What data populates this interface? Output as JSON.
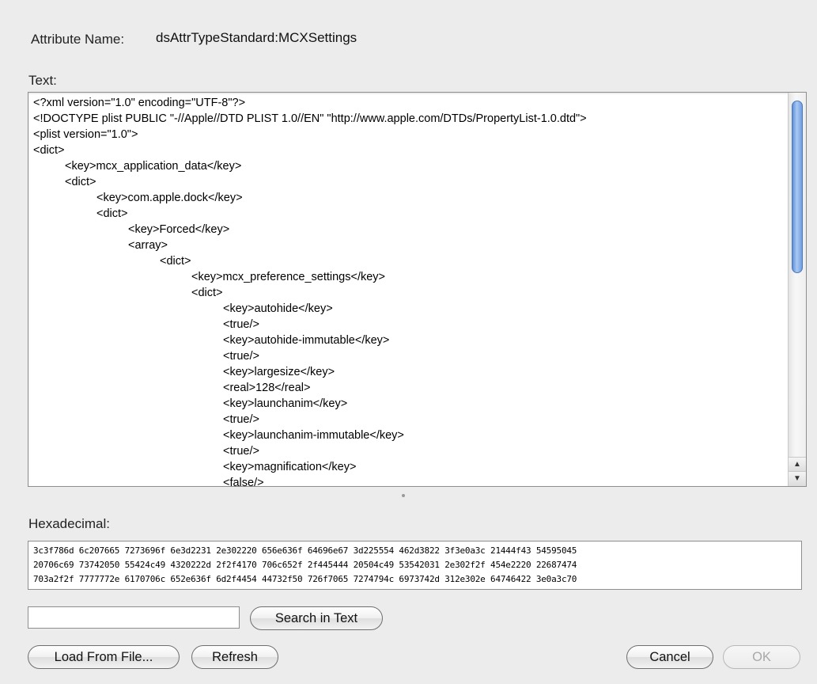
{
  "attribute": {
    "label": "Attribute Name:",
    "value": "dsAttrTypeStandard:MCXSettings"
  },
  "text_section": {
    "label": "Text:",
    "lines": [
      "<?xml version=\"1.0\" encoding=\"UTF-8\"?>",
      "<!DOCTYPE plist PUBLIC \"-//Apple//DTD PLIST 1.0//EN\" \"http://www.apple.com/DTDs/PropertyList-1.0.dtd\">",
      "<plist version=\"1.0\">",
      "<dict>",
      "\t<key>mcx_application_data</key>",
      "\t<dict>",
      "\t\t<key>com.apple.dock</key>",
      "\t\t<dict>",
      "\t\t\t<key>Forced</key>",
      "\t\t\t<array>",
      "\t\t\t\t<dict>",
      "\t\t\t\t\t<key>mcx_preference_settings</key>",
      "\t\t\t\t\t<dict>",
      "\t\t\t\t\t\t<key>autohide</key>",
      "\t\t\t\t\t\t<true/>",
      "\t\t\t\t\t\t<key>autohide-immutable</key>",
      "\t\t\t\t\t\t<true/>",
      "\t\t\t\t\t\t<key>largesize</key>",
      "\t\t\t\t\t\t<real>128</real>",
      "\t\t\t\t\t\t<key>launchanim</key>",
      "\t\t\t\t\t\t<true/>",
      "\t\t\t\t\t\t<key>launchanim-immutable</key>",
      "\t\t\t\t\t\t<true/>",
      "\t\t\t\t\t\t<key>magnification</key>",
      "\t\t\t\t\t\t<false/>"
    ]
  },
  "hex_section": {
    "label": "Hexadecimal:",
    "lines": [
      "3c3f786d 6c207665 7273696f 6e3d2231 2e302220 656e636f 64696e67 3d225554 462d3822 3f3e0a3c 21444f43 54595045",
      "20706c69 73742050 55424c49 4320222d 2f2f4170 706c652f 2f445444 20504c49 53542031 2e302f2f 454e2220 22687474",
      "703a2f2f 7777772e 6170706c 652e636f 6d2f4454 44732f50 726f7065 7274794c 6973742d 312e302e 64746422 3e0a3c70"
    ]
  },
  "search": {
    "value": "",
    "button_label": "Search in Text"
  },
  "buttons": {
    "load_label": "Load From File...",
    "refresh_label": "Refresh",
    "cancel_label": "Cancel",
    "ok_label": "OK"
  },
  "scroll": {
    "up_arrow": "▲",
    "down_arrow": "▼"
  }
}
